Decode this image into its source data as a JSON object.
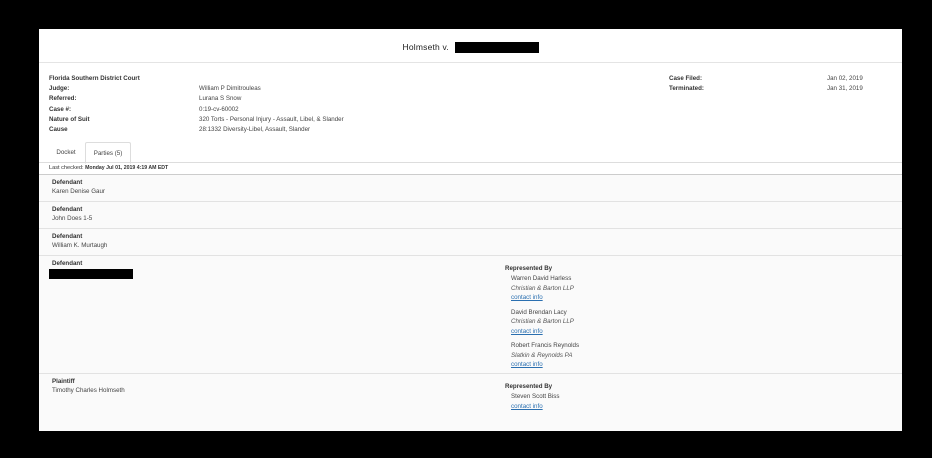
{
  "case": {
    "title_prefix": "Holmseth v.",
    "court": "Florida Southern District Court",
    "fields_left": [
      {
        "label": "Judge:",
        "value": "William P Dimitrouleas"
      },
      {
        "label": "Referred:",
        "value": "Lurana S Snow"
      },
      {
        "label": "Case #:",
        "value": "0:19-cv-60002"
      },
      {
        "label": "Nature of Suit",
        "value": "320 Torts - Personal Injury - Assault, Libel, & Slander"
      },
      {
        "label": "Cause",
        "value": "28:1332 Diversity-Libel, Assault, Slander"
      }
    ],
    "fields_right": [
      {
        "label": "Case Filed:",
        "value": "Jan 02, 2019"
      },
      {
        "label": "Terminated:",
        "value": "Jan 31, 2019"
      }
    ]
  },
  "tabs": [
    {
      "label": "Docket"
    },
    {
      "label": "Parties (5)"
    }
  ],
  "last_checked": {
    "label": "Last checked:",
    "value": "Monday Jul 01, 2019 4:19 AM EDT"
  },
  "parties": [
    {
      "role": "Defendant",
      "name": "Karen Denise Gaur"
    },
    {
      "role": "Defendant",
      "name": "John Does 1-5"
    },
    {
      "role": "Defendant",
      "name": "William K. Murtaugh"
    },
    {
      "role": "Defendant",
      "name": "",
      "represented_by": "Represented By",
      "attorneys": [
        {
          "name": "Warren David Harless",
          "firm": "Christian & Barton LLP",
          "contact": "contact info"
        },
        {
          "name": "David Brendan Lacy",
          "firm": "Christian & Barton LLP",
          "contact": "contact info"
        },
        {
          "name": "Robert Francis Reynolds",
          "firm": "Slatkin & Reynolds PA",
          "contact": "contact info"
        }
      ]
    },
    {
      "role": "Plaintiff",
      "name": "Timothy Charles Holmseth",
      "represented_by": "Represented By",
      "attorneys": [
        {
          "name": "Steven Scott Biss",
          "firm": "",
          "contact": "contact info"
        }
      ]
    }
  ]
}
